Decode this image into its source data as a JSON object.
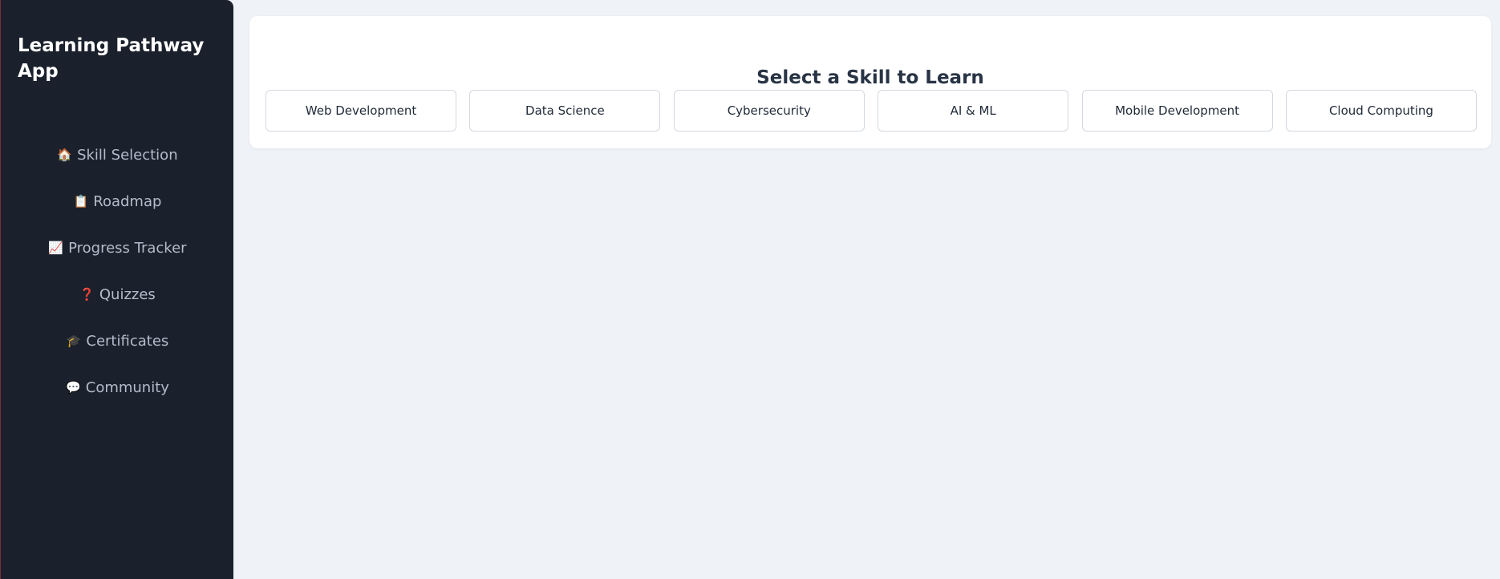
{
  "app": {
    "title": "Learning Pathway App"
  },
  "sidebar": {
    "items": [
      {
        "icon": "🏠",
        "icon_name": "home-icon",
        "label": "Skill Selection"
      },
      {
        "icon": "📋",
        "icon_name": "clipboard-icon",
        "label": "Roadmap"
      },
      {
        "icon": "📈",
        "icon_name": "chart-increasing-icon",
        "label": "Progress Tracker"
      },
      {
        "icon": "❓",
        "icon_name": "question-mark-icon",
        "label": "Quizzes"
      },
      {
        "icon": "🎓",
        "icon_name": "graduation-cap-icon",
        "label": "Certificates"
      },
      {
        "icon": "💬",
        "icon_name": "speech-bubble-icon",
        "label": "Community"
      }
    ]
  },
  "main": {
    "title": "Select a Skill to Learn",
    "skills": [
      "Web Development",
      "Data Science",
      "Cybersecurity",
      "AI & ML",
      "Mobile Development",
      "Cloud Computing"
    ]
  },
  "colors": {
    "sidebar_background": "#1b212c",
    "page_background": "#eff2f7",
    "card_background": "#ffffff",
    "sidebar_text": "#b3bccb",
    "title_text": "#283445"
  }
}
